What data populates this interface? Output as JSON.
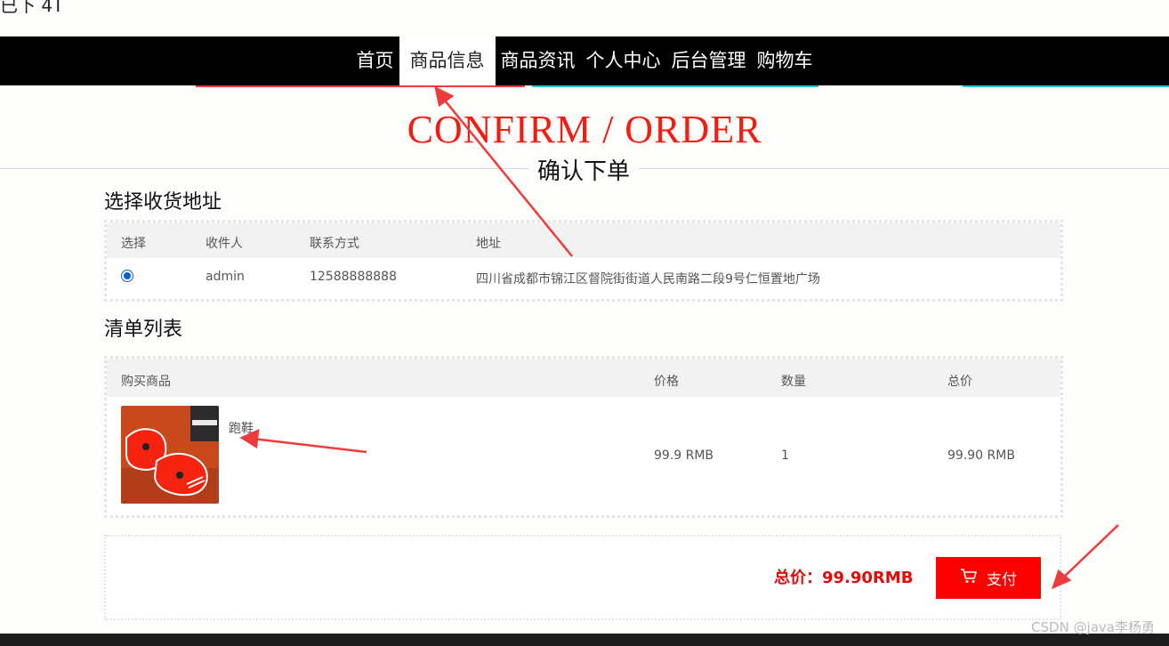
{
  "page": {
    "top_crop_text": "已下 4T"
  },
  "nav": {
    "items": [
      {
        "label": "首页",
        "active": false
      },
      {
        "label": "商品信息",
        "active": true
      },
      {
        "label": "商品资讯",
        "active": false
      },
      {
        "label": "个人中心",
        "active": false
      },
      {
        "label": "后台管理",
        "active": false
      },
      {
        "label": "购物车",
        "active": false
      }
    ]
  },
  "title": {
    "en": "CONFIRM / ORDER",
    "cn": "确认下单"
  },
  "address": {
    "section_title": "选择收货地址",
    "headers": [
      "选择",
      "收件人",
      "联系方式",
      "地址"
    ],
    "row": {
      "selected": true,
      "recipient": "admin",
      "phone": "12588888888",
      "address": "四川省成都市锦江区督院街街道人民南路二段9号仁恒置地广场"
    }
  },
  "items": {
    "section_title": "清单列表",
    "headers": [
      "购买商品",
      "价格",
      "数量",
      "总价"
    ],
    "rows": [
      {
        "name": "跑鞋",
        "price": "99.9 RMB",
        "quantity": "1",
        "total": "99.90 RMB",
        "image_icon": "red-running-shoes-image"
      }
    ]
  },
  "summary": {
    "total_label": "总价：99.90RMB",
    "pay_label": "支付",
    "pay_icon": "cart-icon"
  },
  "watermark": "CSDN @java李杨勇",
  "colors": {
    "accent": "#ff0000",
    "title_red": "#f41c10",
    "nav_bg": "#000000",
    "annotation": "#ee3b3b"
  }
}
